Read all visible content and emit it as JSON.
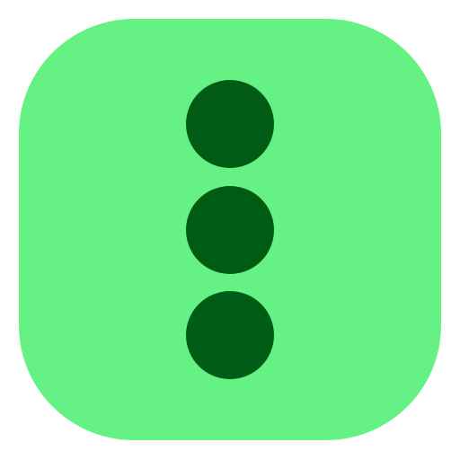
{
  "icon": {
    "name": "more-vertical-icon",
    "tile_color": "#66f184",
    "dot_color": "#005c14",
    "dot_count": 3
  }
}
